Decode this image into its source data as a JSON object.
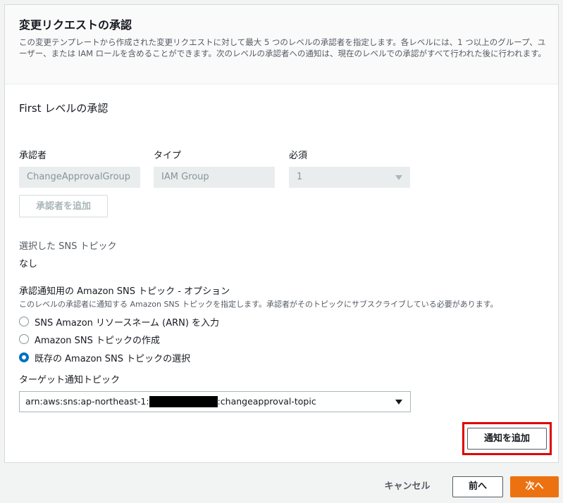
{
  "header": {
    "title": "変更リクエストの承認",
    "description": "この変更テンプレートから作成された変更リクエストに対して最大 5 つのレベルの承認者を指定します。各レベルには、1 つ以上のグループ、ユーザー、または IAM ロールを含めることができます。次のレベルの承認者への通知は、現在のレベルでの承認がすべて行われた後に行われます。"
  },
  "level": {
    "title": "First レベルの承認",
    "approver_label": "承認者",
    "approver_value": "ChangeApprovalGroup",
    "type_label": "タイプ",
    "type_value": "IAM Group",
    "required_label": "必須",
    "required_value": "1",
    "add_approver_label": "承認者を追加"
  },
  "sns": {
    "selected_label": "選択した SNS トピック",
    "selected_value": "なし",
    "option_label": "承認通知用の Amazon SNS トピック - オプション",
    "option_hint": "このレベルの承認者に通知する Amazon SNS トピックを指定します。承認者がそのトピックにサブスクライブしている必要があります。",
    "radio_options": [
      "SNS Amazon リソースネーム (ARN) を入力",
      "Amazon SNS トピックの作成",
      "既存の Amazon SNS トピックの選択"
    ],
    "selected_option": "既存の Amazon SNS トピックの選択",
    "target_label": "ターゲット通知トピック",
    "target_prefix": "arn:aws:sns:ap-northeast-1:",
    "target_suffix": ":changeapproval-topic",
    "add_notification_label": "通知を追加"
  },
  "footer": {
    "cancel_label": "キャンセル",
    "prev_label": "前へ",
    "next_label": "次へ"
  },
  "colors": {
    "primary_button": "#ec7211",
    "radio_selected": "#0073bb",
    "highlight_box": "#e00000"
  }
}
